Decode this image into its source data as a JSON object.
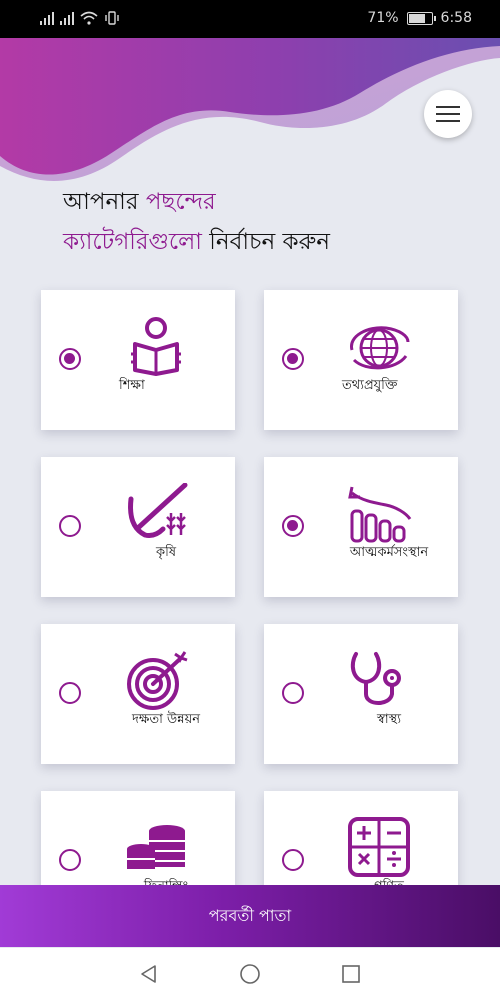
{
  "status_bar": {
    "battery": "71%",
    "time": "6:58"
  },
  "heading": {
    "line1_a": "আপনার",
    "line1_b": "পছন্দের",
    "line2_a": "ক্যাটেগরিগুলো",
    "line2_b": "নির্বাচন করুন"
  },
  "categories": [
    {
      "label": "শিক্ষা",
      "icon": "reading-person-icon",
      "selected": true
    },
    {
      "label": "তথ্যপ্রযুক্তি",
      "icon": "globe-icon",
      "selected": true
    },
    {
      "label": "কৃষি",
      "icon": "plant-sprout-icon",
      "selected": false
    },
    {
      "label": "আত্মকর্মসংস্থান",
      "icon": "growth-chart-icon",
      "selected": true
    },
    {
      "label": "দক্ষতা উন্নয়ন",
      "icon": "target-arrow-icon",
      "selected": false
    },
    {
      "label": "স্বাস্থ্য",
      "icon": "stethoscope-icon",
      "selected": false
    },
    {
      "label": "ফিনান্সিং",
      "icon": "coins-stack-icon",
      "selected": false
    },
    {
      "label": "গণিত",
      "icon": "calculator-icon",
      "selected": false
    }
  ],
  "next_button": "পরবর্তী পাতা",
  "colors": {
    "accent": "#8e1a8f",
    "background": "#e7e9f0"
  }
}
